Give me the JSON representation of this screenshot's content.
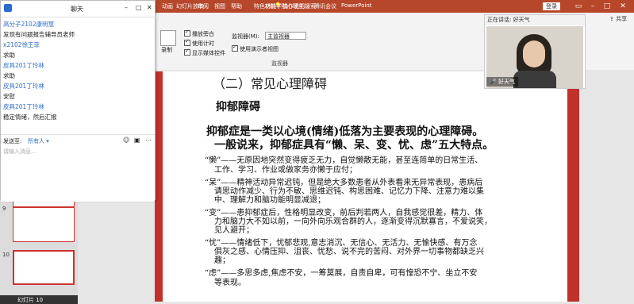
{
  "titlebar": {
    "tabs": [
      "动画",
      "幻灯片放映",
      "审阅",
      "视图",
      "帮助",
      "特色功能"
    ],
    "search_hint": "操作说明搜索",
    "doc_title": "材料学院心理主...",
    "app_name": "腾讯会议",
    "app_suffix": "PowerPoint",
    "login": "登录",
    "share": "共享"
  },
  "ribbon": {
    "record_label": "录制",
    "options": [
      "播放旁白",
      "使用计时",
      "显示媒体控件"
    ],
    "monitor_label": "监视器(M):",
    "monitor_value": "主监视器",
    "presenter_view": "使用演示者视图",
    "group_monitor": "监视器"
  },
  "chat": {
    "title": "聊天",
    "messages": [
      {
        "text": "高分子2102康明慧",
        "kind": "name"
      },
      {
        "text": "发现有问题报告辅导员老师",
        "kind": "msg"
      },
      {
        "text": "x2102徐王菲",
        "kind": "name"
      },
      {
        "text": "求助",
        "kind": "msg"
      },
      {
        "text": "皮具201丁玲林",
        "kind": "name"
      },
      {
        "text": "求助",
        "kind": "msg"
      },
      {
        "text": "皮具201丁玲林",
        "kind": "name"
      },
      {
        "text": "安慰",
        "kind": "msg"
      },
      {
        "text": "皮具201丁玲林",
        "kind": "name"
      },
      {
        "text": "稳定情绪，然后汇报",
        "kind": "msg"
      }
    ],
    "send_to_label": "发送至:",
    "send_to_value": "所有人",
    "input_placeholder": "请输入消息...",
    "accent": "#2a6ccf"
  },
  "video": {
    "speaking_label": "正在讲话: 好天气",
    "participant_name": "好天气"
  },
  "slide": {
    "section_title": "（二）常见心理障碍",
    "heading": "抑郁障碍",
    "intro_line1": "抑郁症是一类以心境(情绪)低落为主要表现的心理障碍。",
    "intro_line2": "一般说来，抑郁症具有“懒、呆、变、忧、虑”五大特点。",
    "points": [
      [
        "“懒”——无原因地突然变得疲乏无力，自觉懒散无能，甚至连简单的日常生活、",
        "工作、学习、作业或做家务亦懒于应付；"
      ],
      [
        "“呆”——精神活动异常迟钝，但是绝大多数患者从外表看来无异常表现，患病后",
        "请思动作减少、行为不敏、思维迟钝、构思困难、记忆力下降、注意力难以集",
        "中、理解力和脑功能明显减退；"
      ],
      [
        "“变”——患抑郁症后，性格明显改变，前后判若两人，自我感觉很差，精力、体",
        "力和脑力大不如以前，一向外向乐观合群的人，逐渐变得沉默寡言，不爱说笑，",
        "见人避开；"
      ],
      [
        "“忧”——情绪低下，忧郁悲观,意志消沉、无信心、无活力、无愉快感、有万念",
        "俱灰之感、心情压抑、沮丧、忧愁、说不完的苦闷、对外界一切事物都缺乏兴",
        "趣；"
      ],
      [
        "“虑”——多思多虑,焦虑不安，一筹莫展，自责自卑，可有惶恐不宁、坐立不安",
        "等表现。"
      ]
    ],
    "accent": "#c0312b"
  },
  "thumbnails": {
    "numbers": [
      "9",
      "10"
    ]
  },
  "statusbar": {
    "text": "幻灯片 10"
  }
}
